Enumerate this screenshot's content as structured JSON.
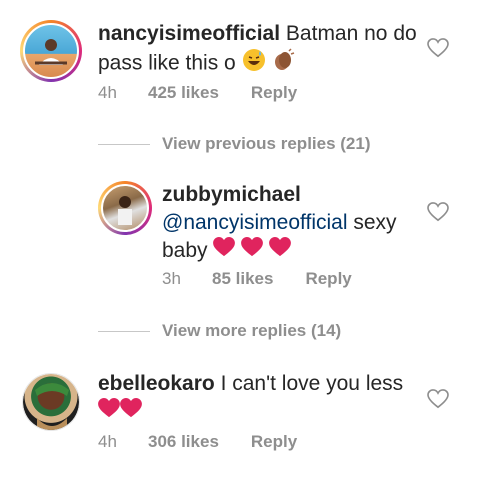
{
  "comments": [
    {
      "username": "nancyisimeofficial",
      "text_line1": "Batman no do",
      "text_line2": "pass like this o",
      "emojis": [
        "grinning-sweat-face",
        "clapping-hands"
      ],
      "time": "4h",
      "likes": "425 likes",
      "reply": "Reply"
    },
    {
      "username": "zubbymichael",
      "mention": "@nancyisimeofficial",
      "text_line1_suffix": " sexy",
      "text_line2": "baby",
      "emojis": [
        "red-heart",
        "red-heart",
        "red-heart"
      ],
      "time": "3h",
      "likes": "85 likes",
      "reply": "Reply"
    },
    {
      "username": "ebelleokaro",
      "text_line1": " I can't love you less",
      "emojis": [
        "red-heart",
        "red-heart"
      ],
      "time": "4h",
      "likes": "306 likes",
      "reply": "Reply"
    }
  ],
  "view_previous": "View previous replies (21)",
  "view_more": "View more replies (14)",
  "colors": {
    "text": "#262626",
    "meta": "#8e8e8e",
    "mention": "#003569",
    "heart": "#e0245e"
  }
}
